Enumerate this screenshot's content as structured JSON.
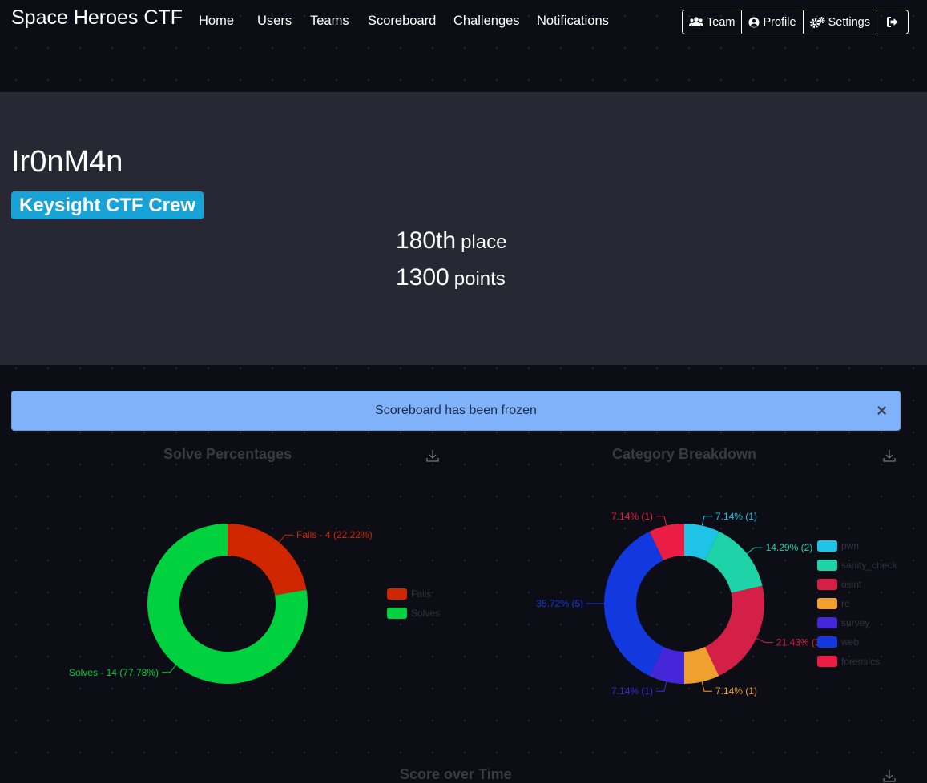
{
  "navbar": {
    "brand": "Space Heroes CTF",
    "links": [
      "Home",
      "Users",
      "Teams",
      "Scoreboard",
      "Challenges",
      "Notifications"
    ],
    "buttons": {
      "team": "Team",
      "profile": "Profile",
      "settings": "Settings"
    }
  },
  "profile": {
    "username": "Ir0nM4n",
    "team": "Keysight CTF Crew",
    "place_value": "180th",
    "place_label": "place",
    "points_value": "1300",
    "points_label": "points"
  },
  "alert": {
    "message": "Scoreboard has been frozen",
    "close": "×"
  },
  "charts": {
    "solve_title": "Solve Percentages",
    "category_title": "Category Breakdown",
    "score_title": "Score over Time"
  },
  "chart_data": [
    {
      "type": "pie",
      "title": "Solve Percentages",
      "categories": [
        "Fails",
        "Solves"
      ],
      "values": [
        4,
        14
      ],
      "labels": [
        "Fails - 4 (22.22%)",
        "Solves - 14 (77.78%)"
      ],
      "colors": [
        "#cf2600",
        "#00d13f"
      ],
      "legend": "right"
    },
    {
      "type": "pie",
      "title": "Category Breakdown",
      "categories": [
        "pwn",
        "sanity_check",
        "osint",
        "re",
        "survey",
        "web",
        "forensics"
      ],
      "values": [
        1,
        2,
        3,
        1,
        1,
        5,
        1
      ],
      "labels": [
        "7.14% (1)",
        "14.29% (2)",
        "21.43% (3)",
        "7.14% (1)",
        "7.14% (1)",
        "35.72% (5)",
        "7.14% (1)"
      ],
      "colors": [
        "#1fc3e6",
        "#1fd3a9",
        "#d41f46",
        "#f0a02f",
        "#4526d8",
        "#1238e0",
        "#ec1d44"
      ],
      "legend": "right"
    }
  ]
}
